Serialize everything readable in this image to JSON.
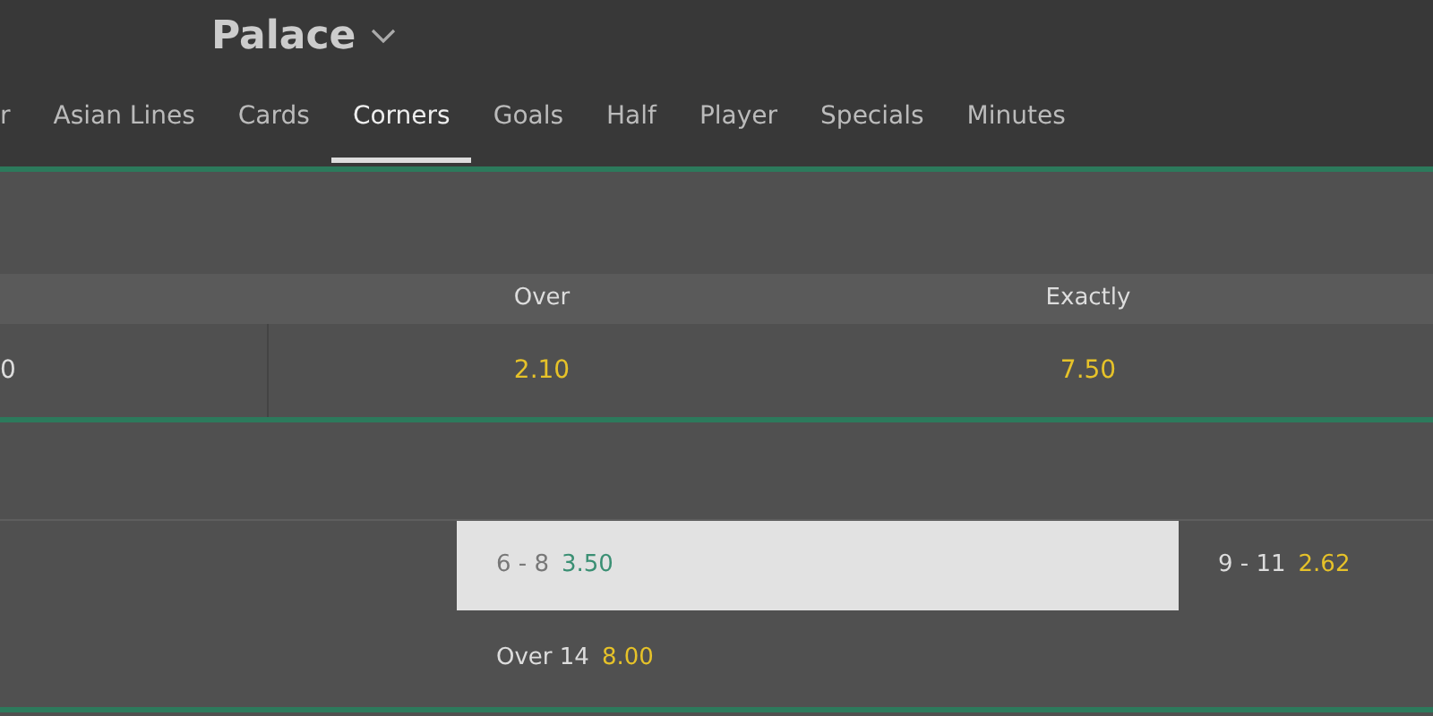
{
  "header": {
    "title": "Palace"
  },
  "tabs": [
    {
      "label": "r",
      "selected": false
    },
    {
      "label": "Asian Lines",
      "selected": false
    },
    {
      "label": "Cards",
      "selected": false
    },
    {
      "label": "Corners",
      "selected": true
    },
    {
      "label": "Goals",
      "selected": false
    },
    {
      "label": "Half",
      "selected": false
    },
    {
      "label": "Player",
      "selected": false
    },
    {
      "label": "Specials",
      "selected": false
    },
    {
      "label": "Minutes",
      "selected": false
    }
  ],
  "market_1": {
    "columns": [
      "Over",
      "Exactly"
    ],
    "row": {
      "line": "0",
      "odds": [
        "2.10",
        "7.50"
      ]
    }
  },
  "market_2": {
    "rows": [
      [
        {
          "label": "6 - 8",
          "odds": "3.50",
          "selected": true
        },
        {
          "label": "9 - 11",
          "odds": "2.62",
          "selected": false
        }
      ],
      [
        {
          "label": "Over 14",
          "odds": "8.00",
          "selected": false
        }
      ]
    ]
  }
}
